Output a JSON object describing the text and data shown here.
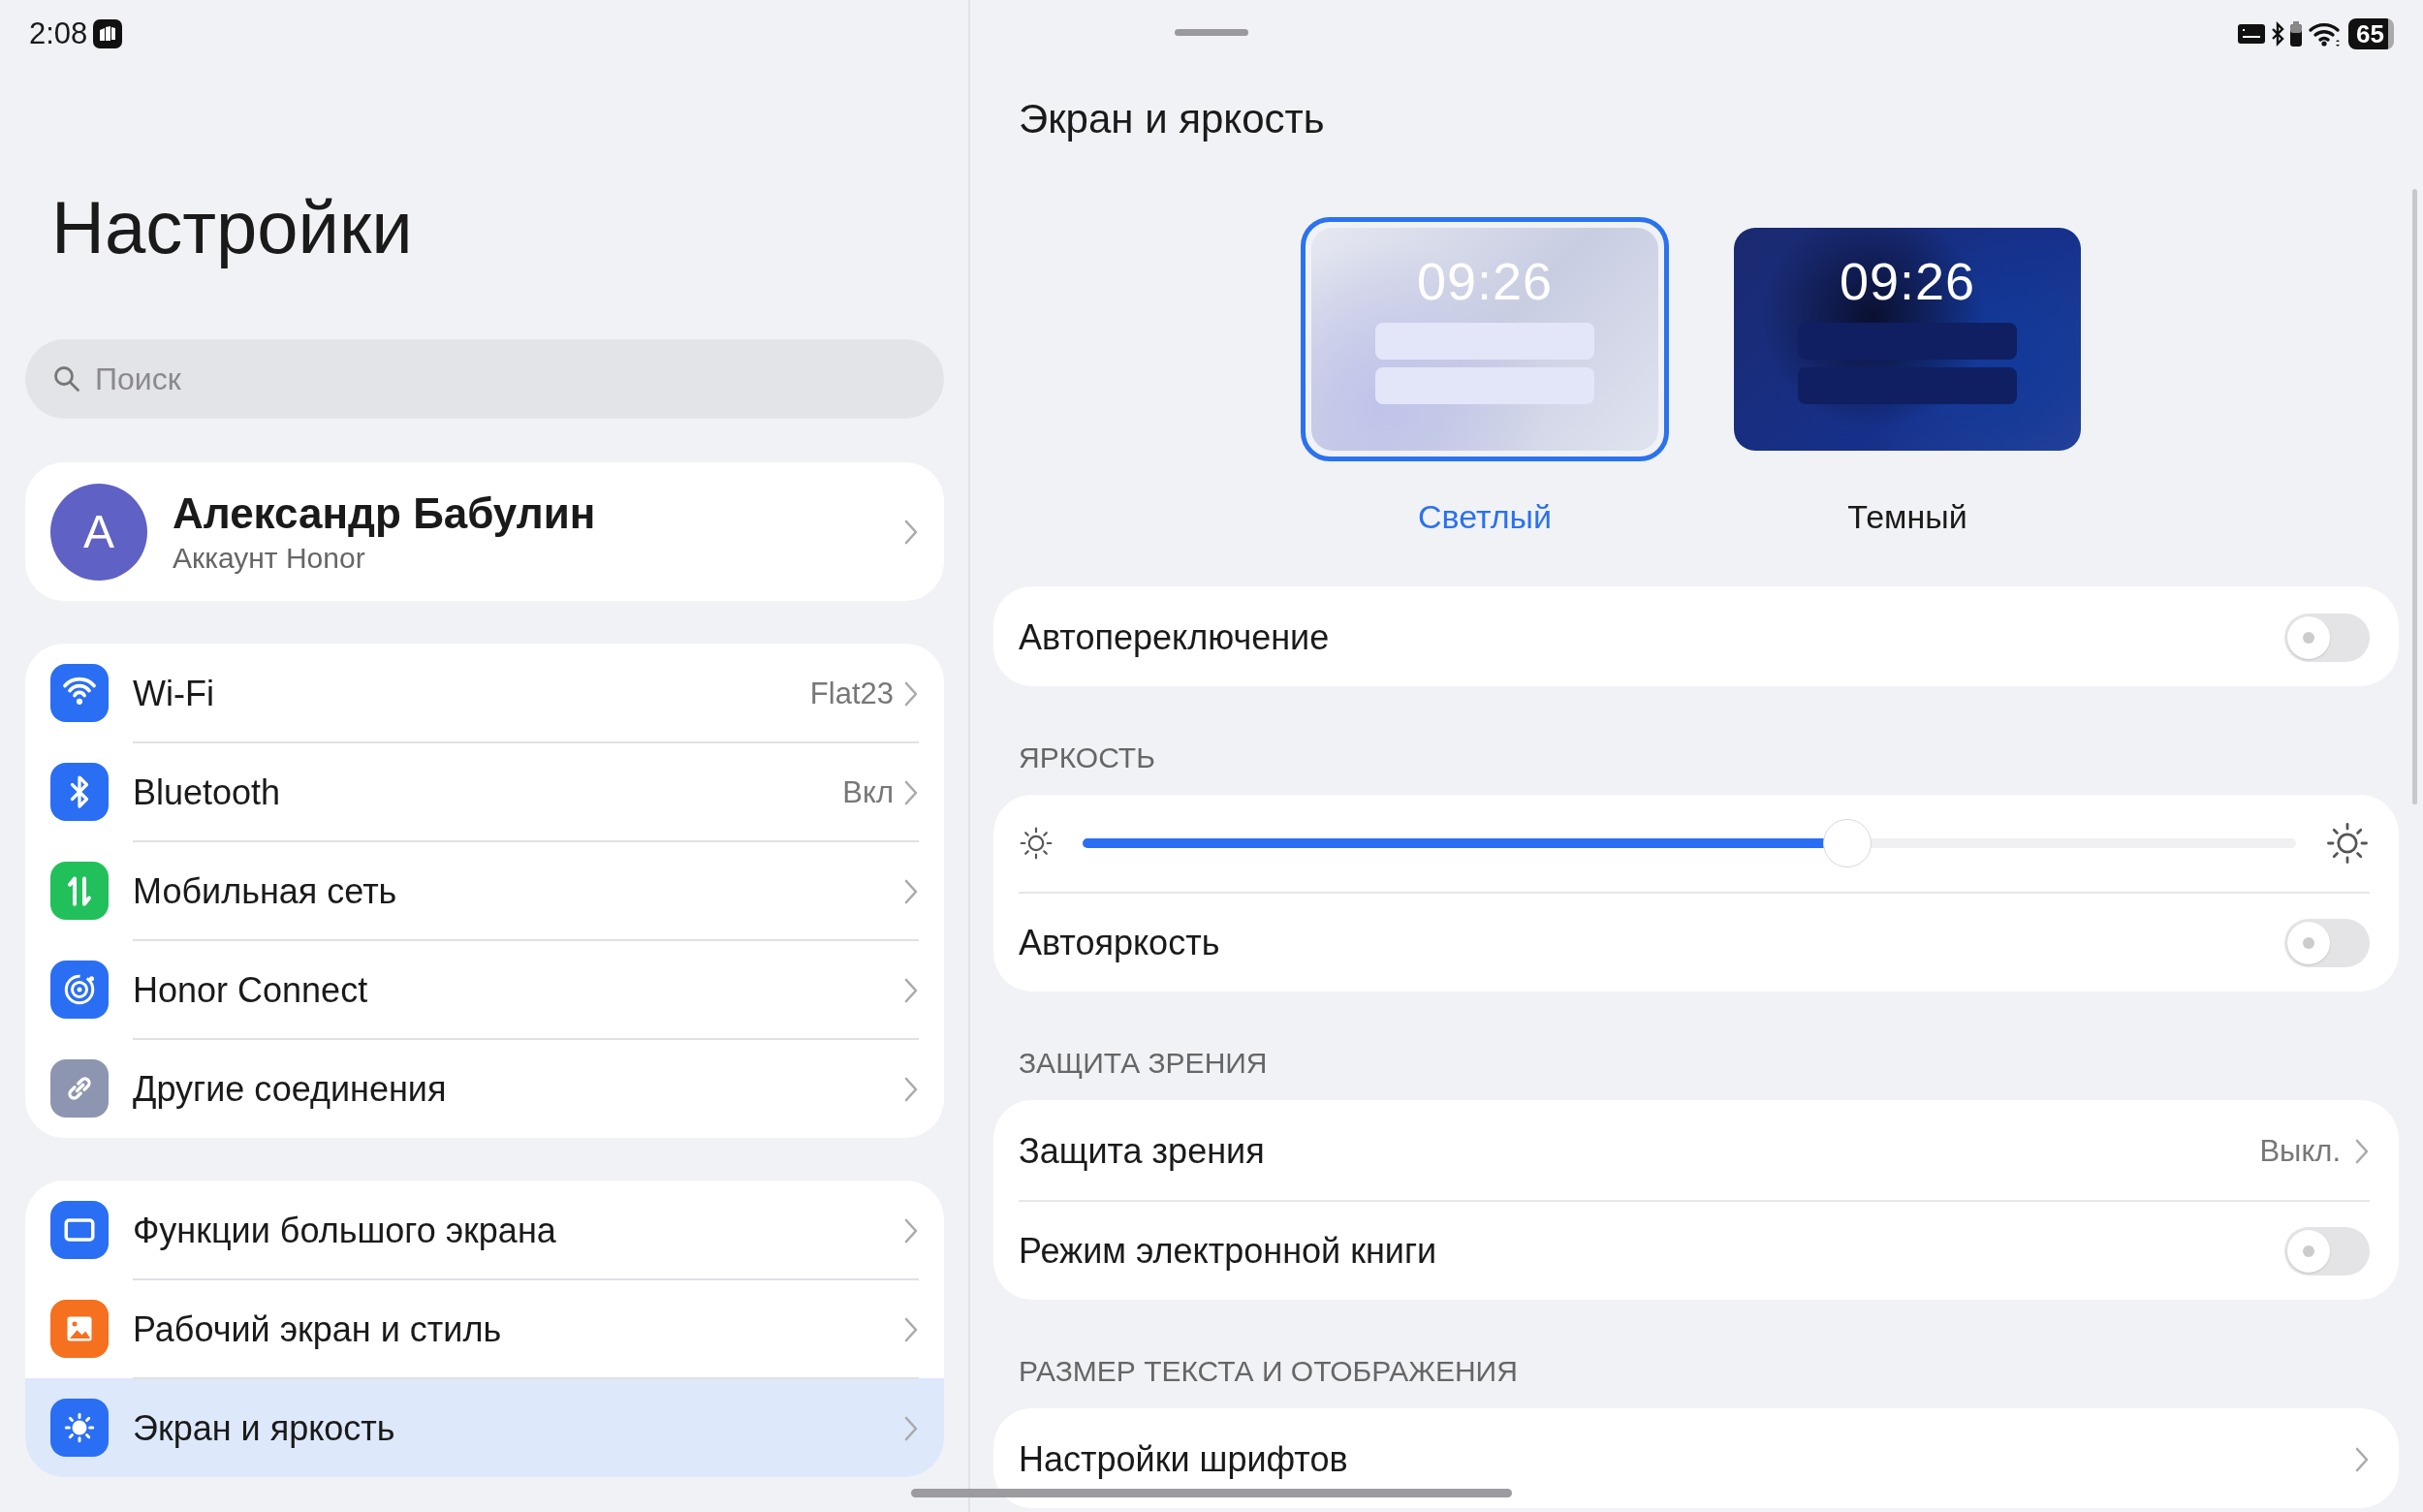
{
  "status_bar": {
    "time": "2:08",
    "battery": "65"
  },
  "sidebar": {
    "title": "Настройки",
    "search": {
      "placeholder": "Поиск"
    },
    "account": {
      "initial": "А",
      "name": "Александр Бабулин",
      "subtitle": "Аккаунт Honor"
    },
    "groups": [
      {
        "items": [
          {
            "label": "Wi-Fi",
            "value": "Flat23",
            "selected": false
          },
          {
            "label": "Bluetooth",
            "value": "Вкл",
            "selected": false
          },
          {
            "label": "Мобильная сеть",
            "selected": false
          },
          {
            "label": "Honor Connect",
            "selected": false
          },
          {
            "label": "Другие соединения",
            "selected": false
          }
        ]
      },
      {
        "items": [
          {
            "label": "Функции большого экрана",
            "selected": false
          },
          {
            "label": "Рабочий экран и стиль",
            "selected": false
          },
          {
            "label": "Экран и яркость",
            "selected": true
          }
        ]
      }
    ]
  },
  "detail": {
    "title": "Экран и яркость",
    "themes": [
      {
        "kind": "light",
        "clock": "09:26",
        "label": "Светлый",
        "selected": true
      },
      {
        "kind": "dark",
        "clock": "09:26",
        "label": "Темный",
        "selected": false
      }
    ],
    "sections": [
      {
        "items": [
          {
            "kind": "toggle",
            "label": "Автопереключение",
            "on": false
          }
        ]
      },
      {
        "header": "ЯРКОСТЬ",
        "items": [
          {
            "kind": "slider",
            "level": 0.63
          },
          {
            "kind": "toggle",
            "label": "Автояркость",
            "on": false
          }
        ]
      },
      {
        "header": "ЗАЩИТА ЗРЕНИЯ",
        "items": [
          {
            "kind": "link",
            "label": "Защита зрения",
            "value": "Выкл."
          },
          {
            "kind": "toggle",
            "label": "Режим электронной книги",
            "on": false
          }
        ]
      },
      {
        "header": "РАЗМЕР ТЕКСТА И ОТОБРАЖЕНИЯ",
        "items": [
          {
            "kind": "link",
            "label": "Настройки шрифтов"
          }
        ]
      }
    ]
  }
}
